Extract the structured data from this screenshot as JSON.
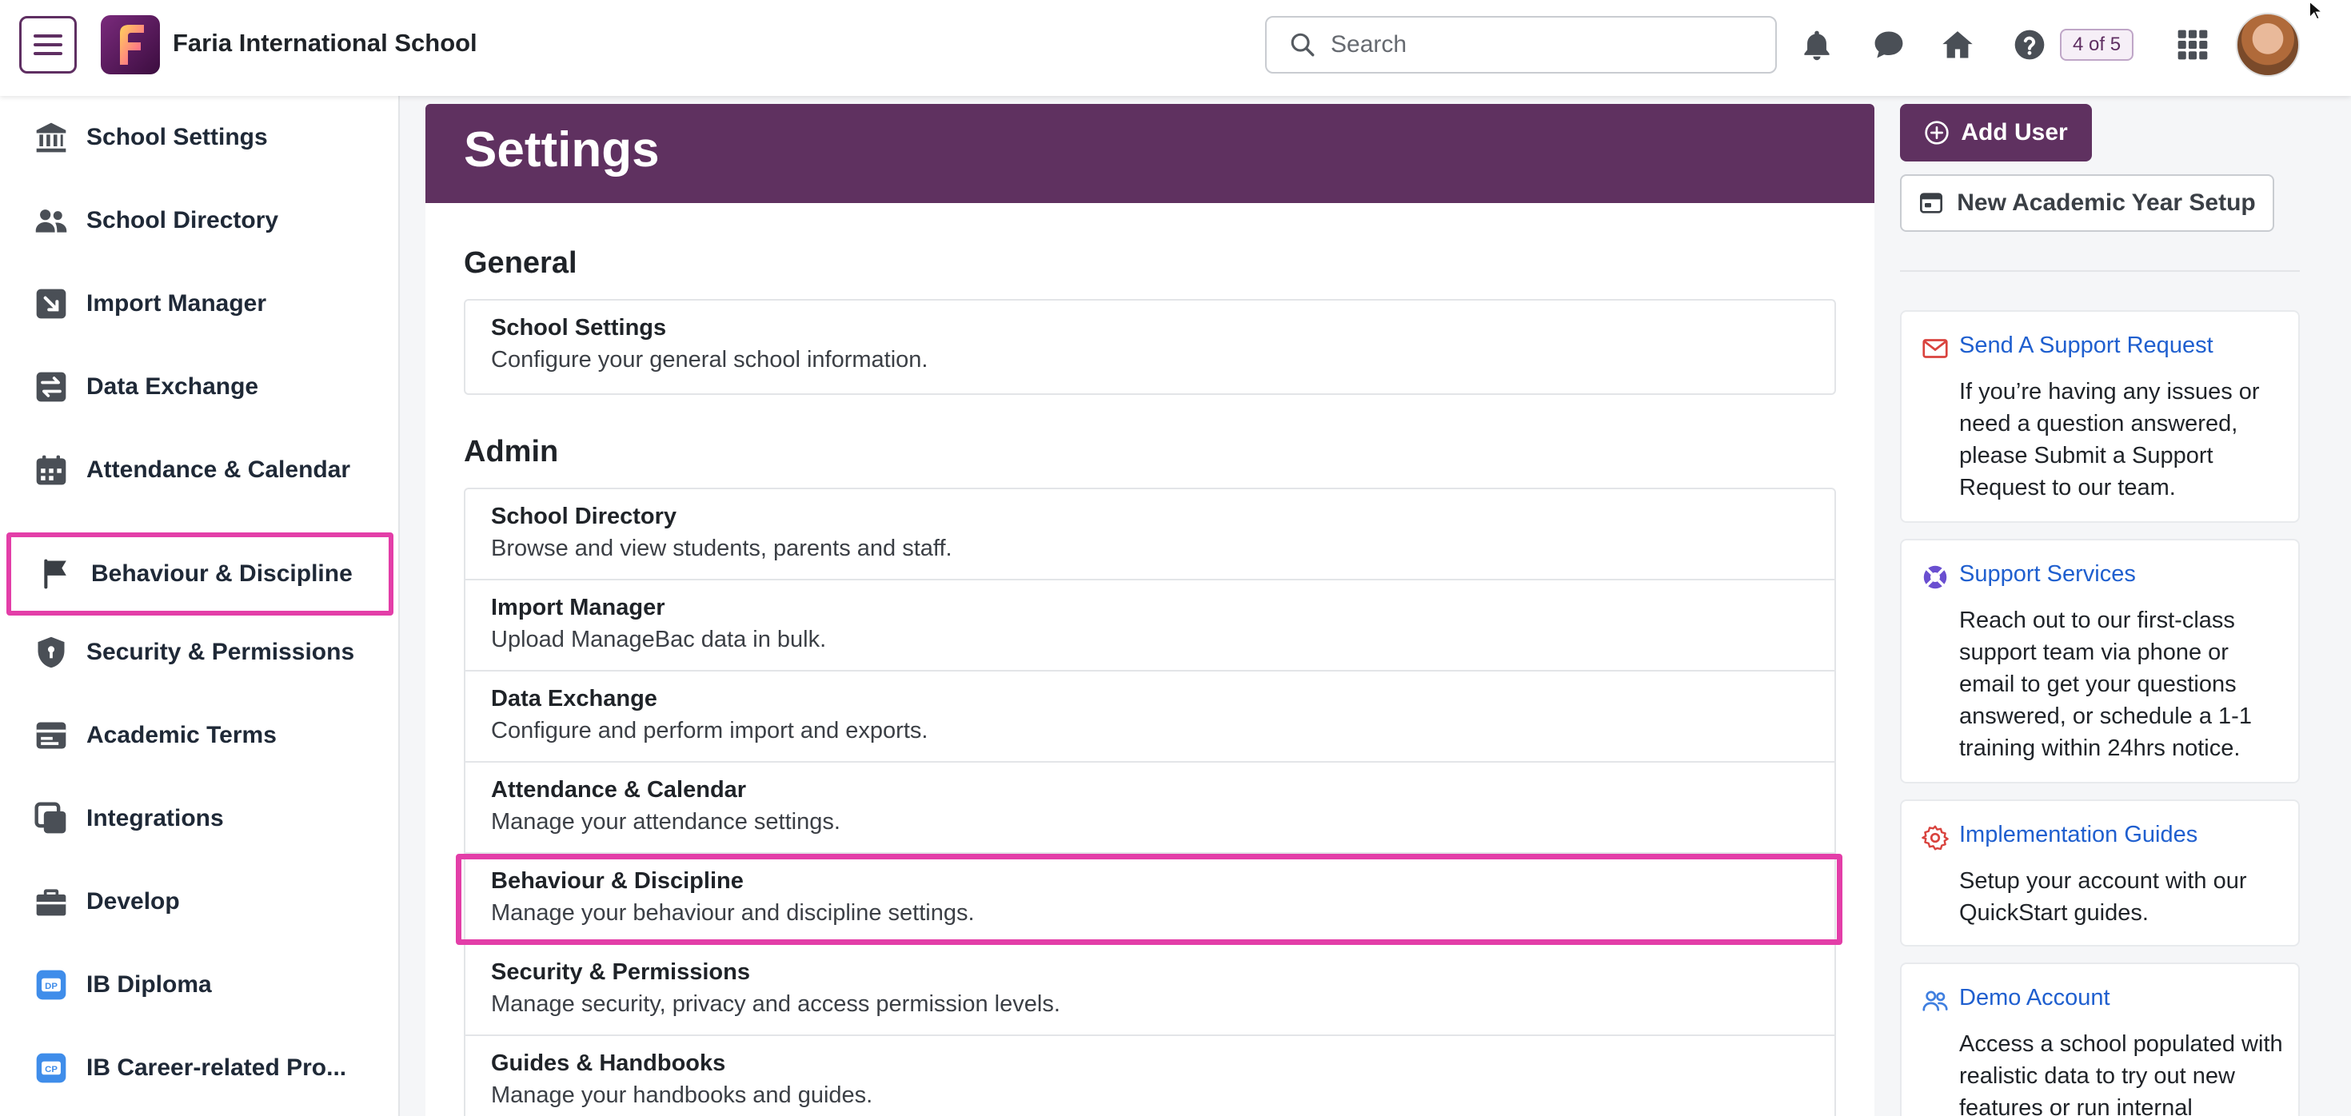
{
  "topbar": {
    "school_name": "Faria International School",
    "logo_letter": "F",
    "search_placeholder": "Search",
    "pager": "4 of 5"
  },
  "sidebar": {
    "items": [
      {
        "label": "School Settings",
        "icon": "bank-icon"
      },
      {
        "label": "School Directory",
        "icon": "people-icon"
      },
      {
        "label": "Import Manager",
        "icon": "import-arrow-icon"
      },
      {
        "label": "Data Exchange",
        "icon": "exchange-icon"
      },
      {
        "label": "Attendance & Calendar",
        "icon": "calendar-icon"
      },
      {
        "label": "Behaviour & Discipline",
        "icon": "flag-icon"
      },
      {
        "label": "Security & Permissions",
        "icon": "shield-icon"
      },
      {
        "label": "Academic Terms",
        "icon": "terms-icon"
      },
      {
        "label": "Integrations",
        "icon": "integrations-icon"
      },
      {
        "label": "Develop",
        "icon": "briefcase-icon"
      },
      {
        "label": "IB Diploma",
        "icon": "ib-dp-icon",
        "badge": "DP"
      },
      {
        "label": "IB Career-related Pro...",
        "icon": "ib-cp-icon",
        "badge": "CP"
      }
    ]
  },
  "main": {
    "title": "Settings",
    "general": {
      "heading": "General",
      "items": [
        {
          "title": "School Settings",
          "desc": "Configure your general school information."
        }
      ]
    },
    "admin": {
      "heading": "Admin",
      "items": [
        {
          "title": "School Directory",
          "desc": "Browse and view students, parents and staff."
        },
        {
          "title": "Import Manager",
          "desc": "Upload ManageBac data in bulk."
        },
        {
          "title": "Data Exchange",
          "desc": "Configure and perform import and exports."
        },
        {
          "title": "Attendance & Calendar",
          "desc": "Manage your attendance settings."
        },
        {
          "title": "Behaviour & Discipline",
          "desc": "Manage your behaviour and discipline settings."
        },
        {
          "title": "Security & Permissions",
          "desc": "Manage security, privacy and access permission levels."
        },
        {
          "title": "Guides & Handbooks",
          "desc": "Manage your handbooks and guides."
        }
      ]
    }
  },
  "right": {
    "add_user": "Add User",
    "new_year": "New Academic Year Setup",
    "cards": [
      {
        "title": "Send A Support Request",
        "desc": "If you’re having any issues or need a question answered, please Submit a Support Request to our team."
      },
      {
        "title": "Support Services",
        "desc": "Reach out to our first-class support team via phone or email to get your questions answered, or schedule a 1-1 training within 24hrs notice."
      },
      {
        "title": "Implementation Guides",
        "desc": "Setup your account with our QuickStart guides."
      },
      {
        "title": "Demo Account",
        "desc": "Access a school populated with realistic data to try out new features or run internal"
      }
    ]
  },
  "colors": {
    "brand": "#5f3160",
    "highlight": "#e33ea8",
    "link": "#1f5fcf"
  }
}
